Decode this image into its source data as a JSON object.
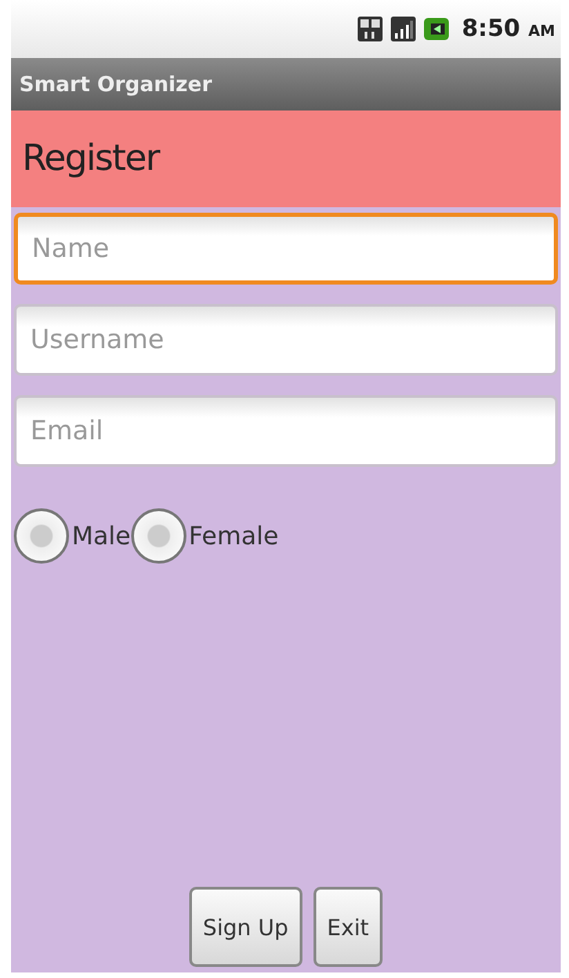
{
  "status_bar": {
    "time": "8:50",
    "ampm": "AM"
  },
  "window": {
    "title": "Smart Organizer"
  },
  "header": {
    "title": "Register"
  },
  "fields": [
    {
      "placeholder": "Name",
      "focused": true
    },
    {
      "placeholder": "Username",
      "focused": false
    },
    {
      "placeholder": "Email",
      "focused": false
    }
  ],
  "gender": [
    {
      "label": "Male",
      "selected": false
    },
    {
      "label": "Female",
      "selected": false
    }
  ],
  "buttons": [
    "Sign Up",
    "Exit"
  ]
}
